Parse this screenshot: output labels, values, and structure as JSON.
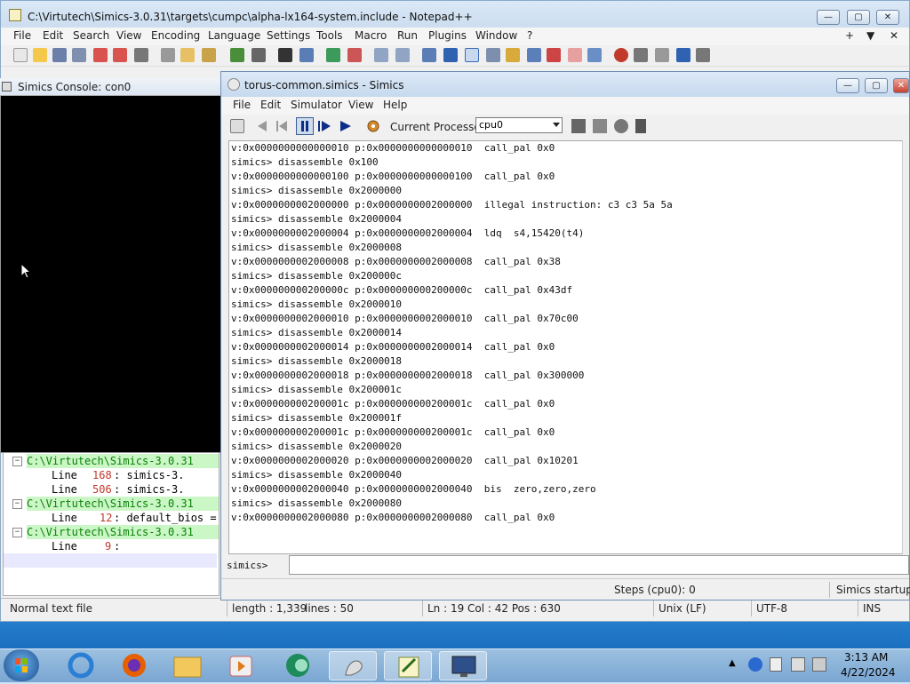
{
  "notepad": {
    "title": "C:\\Virtutech\\Simics-3.0.31\\targets\\cumpc\\alpha-lx164-system.include - Notepad++",
    "window_buttons": {
      "minimize": "—",
      "maximize": "▢",
      "close": "✕"
    },
    "menu": [
      "File",
      "Edit",
      "Search",
      "View",
      "Encoding",
      "Language",
      "Settings",
      "Tools",
      "Macro",
      "Run",
      "Plugins",
      "Window",
      "?"
    ],
    "menu_right": [
      "+",
      "▼",
      "✕"
    ],
    "status": {
      "type": "Normal text file",
      "length": "length : 1,339",
      "lines": "lines : 50",
      "pos": "Ln : 19    Col : 42    Pos : 630",
      "eol": "Unix (LF)",
      "encoding": "UTF-8",
      "mode": "INS"
    },
    "find_results": [
      {
        "kind": "header",
        "text": "C:\\Virtutech\\Simics-3.0.31"
      },
      {
        "kind": "line",
        "label": "Line",
        "num": "168",
        "text": ":      simics-3."
      },
      {
        "kind": "line",
        "label": "Line",
        "num": "506",
        "text": ":      simics-3."
      },
      {
        "kind": "header",
        "text": "C:\\Virtutech\\Simics-3.0.31"
      },
      {
        "kind": "line",
        "label": "Line",
        "num": "12",
        "text": ": default_bios ="
      },
      {
        "kind": "header",
        "text": "C:\\Virtutech\\Simics-3.0.31"
      },
      {
        "kind": "line",
        "label": "Line",
        "num": "9",
        "text": ":"
      }
    ]
  },
  "console": {
    "title": "Simics Console: con0"
  },
  "simics": {
    "title": "torus-common.simics - Simics",
    "menu": [
      "File",
      "Edit",
      "Simulator",
      "View",
      "Help"
    ],
    "processor_label": "Current Processor:",
    "processor_value": "cpu0",
    "output": [
      "v:0x0000000000000010 p:0x0000000000000010  call_pal 0x0",
      "simics> disassemble 0x100",
      "v:0x0000000000000100 p:0x0000000000000100  call_pal 0x0",
      "simics> disassemble 0x2000000",
      "v:0x0000000002000000 p:0x0000000002000000  illegal instruction: c3 c3 5a 5a",
      "simics> disassemble 0x2000004",
      "v:0x0000000002000004 p:0x0000000002000004  ldq  s4,15420(t4)",
      "simics> disassemble 0x2000008",
      "v:0x0000000002000008 p:0x0000000002000008  call_pal 0x38",
      "simics> disassemble 0x200000c",
      "v:0x000000000200000c p:0x000000000200000c  call_pal 0x43df",
      "simics> disassemble 0x2000010",
      "v:0x0000000002000010 p:0x0000000002000010  call_pal 0x70c00",
      "simics> disassemble 0x2000014",
      "v:0x0000000002000014 p:0x0000000002000014  call_pal 0x0",
      "simics> disassemble 0x2000018",
      "v:0x0000000002000018 p:0x0000000002000018  call_pal 0x300000",
      "simics> disassemble 0x200001c",
      "v:0x000000000200001c p:0x000000000200001c  call_pal 0x0",
      "simics> disassemble 0x200001f",
      "v:0x000000000200001c p:0x000000000200001c  call_pal 0x0",
      "simics> disassemble 0x2000020",
      "v:0x0000000002000020 p:0x0000000002000020  call_pal 0x10201",
      "simics> disassemble 0x2000040",
      "v:0x0000000002000040 p:0x0000000002000040  bis  zero,zero,zero",
      "simics> disassemble 0x2000080",
      "v:0x0000000002000080 p:0x0000000002000080  call_pal 0x0"
    ],
    "prompt": "simics>",
    "command_value": "",
    "steps": "Steps (cpu0): 0",
    "startup": "Simics startup"
  },
  "taskbar": {
    "time": "3:13 AM",
    "date": "4/22/2024"
  },
  "colors": {
    "findHeaderBg": "#cbf7c6",
    "findHeaderText": "#098006",
    "lineNumber": "#c0392b"
  }
}
